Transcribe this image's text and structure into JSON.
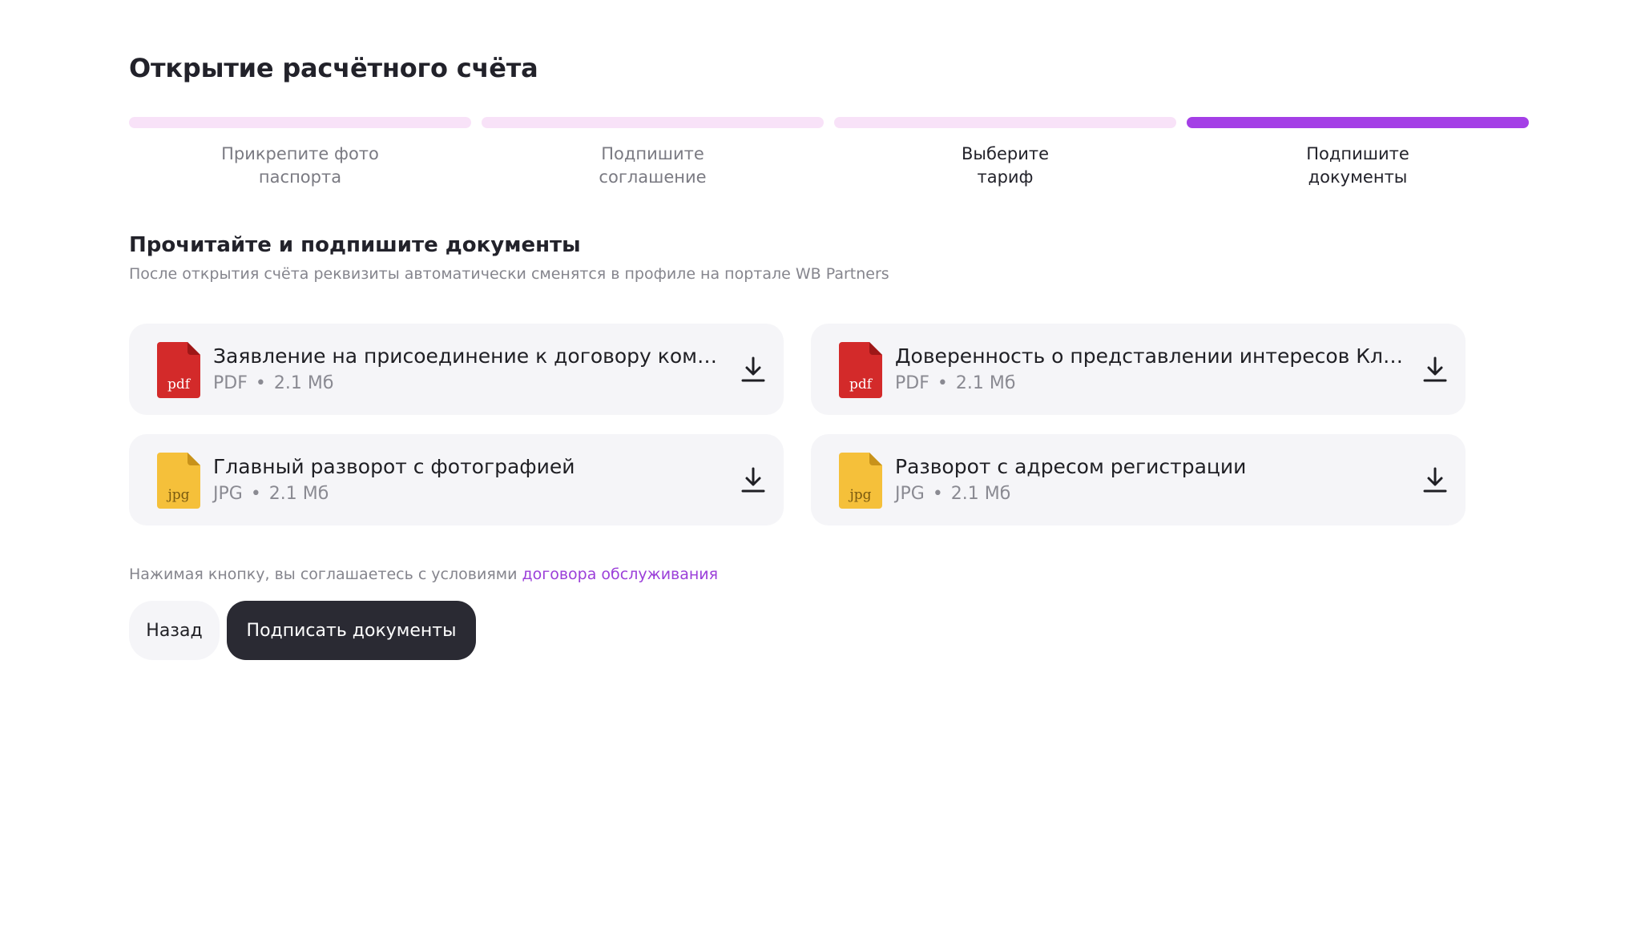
{
  "page": {
    "title": "Открытие расчётного счёта"
  },
  "steps": [
    {
      "label": "Прикрепите фото\nпаспорта",
      "state": "done"
    },
    {
      "label": "Подпишите\nсоглашение",
      "state": "done"
    },
    {
      "label": "Выберите\nтариф",
      "state": "done"
    },
    {
      "label": "Подпишите\nдокументы",
      "state": "current"
    }
  ],
  "section": {
    "title": "Прочитайте и подпишите документы",
    "subtitle": "После открытия счёта реквизиты автоматически сменятся в профиле на портале WB Partners"
  },
  "documents": [
    {
      "name": "Заявление на присоединение к договору комплексного обслуживания",
      "type": "PDF",
      "size": "2.1 Мб",
      "icon": "pdf",
      "icon_label": "pdf"
    },
    {
      "name": "Доверенность о представлении интересов Клиента",
      "type": "PDF",
      "size": "2.1 Мб",
      "icon": "pdf",
      "icon_label": "pdf"
    },
    {
      "name": "Главный разворот с фотографией",
      "type": "JPG",
      "size": "2.1 Мб",
      "icon": "jpg",
      "icon_label": "jpg"
    },
    {
      "name": "Разворот с адресом регистрации",
      "type": "JPG",
      "size": "2.1 Мб",
      "icon": "jpg",
      "icon_label": "jpg"
    }
  ],
  "meta_separator": "•",
  "consent": {
    "text": "Нажимая кнопку, вы соглашаетесь с условиями ",
    "link": "договора обслуживания"
  },
  "buttons": {
    "back": "Назад",
    "sign": "Подписать документы"
  },
  "colors": {
    "accent": "#a43fe6",
    "step_inactive": "#f8e2f8",
    "pdf_icon": "#d32a2a",
    "jpg_icon": "#f5c03a",
    "primary_button": "#2a2a33",
    "link": "#9b3fd9"
  }
}
